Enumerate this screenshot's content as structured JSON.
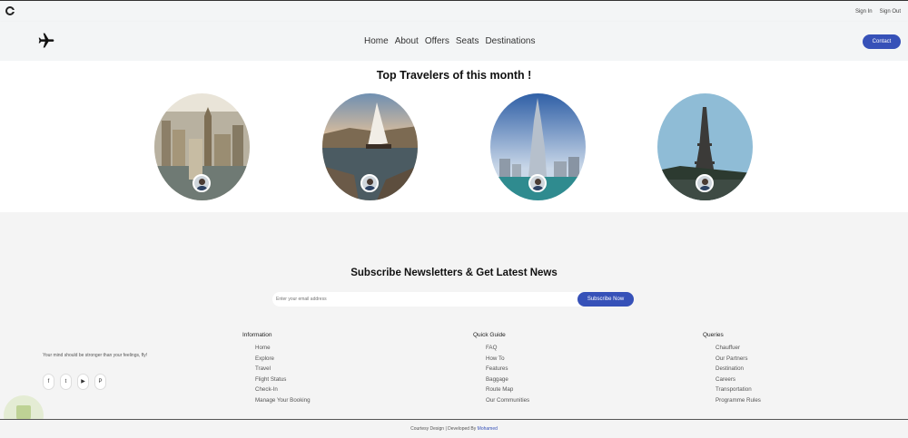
{
  "topbar": {
    "sign_in": "Sign In",
    "sign_out": "Sign Out"
  },
  "nav": {
    "items": [
      "Home",
      "About",
      "Offers",
      "Seats",
      "Destinations"
    ],
    "contact": "Contact"
  },
  "travelers": {
    "title": "Top Travelers of this month !",
    "cards": [
      {
        "place": "london"
      },
      {
        "place": "nile"
      },
      {
        "place": "dubai"
      },
      {
        "place": "paris"
      }
    ]
  },
  "newsletter": {
    "title": "Subscribe Newsletters & Get Latest News",
    "placeholder": "Enter your email address",
    "button": "Subscribe Now"
  },
  "footer": {
    "tagline": "Your mind should be stronger than your feelings, fly!",
    "socials": [
      "facebook-icon",
      "twitter-icon",
      "youtube-icon",
      "pinterest-icon"
    ],
    "information": {
      "title": "Information",
      "items": [
        "Home",
        "Explore",
        "Travel",
        "Flight Status",
        "Check-In",
        "Manage Your Booking"
      ]
    },
    "quick_guide": {
      "title": "Quick Guide",
      "items": [
        "FAQ",
        "How To",
        "Features",
        "Baggage",
        "Route Map",
        "Our Communities"
      ]
    },
    "queries": {
      "title": "Queries",
      "items": [
        "Chauffuer",
        "Our Partners",
        "Destination",
        "Careers",
        "Transportation",
        "Programme Rules"
      ]
    },
    "copyright_prefix": "Courtesy Design | Developed By",
    "author": "Mohamed"
  },
  "colors": {
    "accent": "#3651b8",
    "footer_bg": "#f4f4f4",
    "header_bg": "#f3f5f6"
  }
}
